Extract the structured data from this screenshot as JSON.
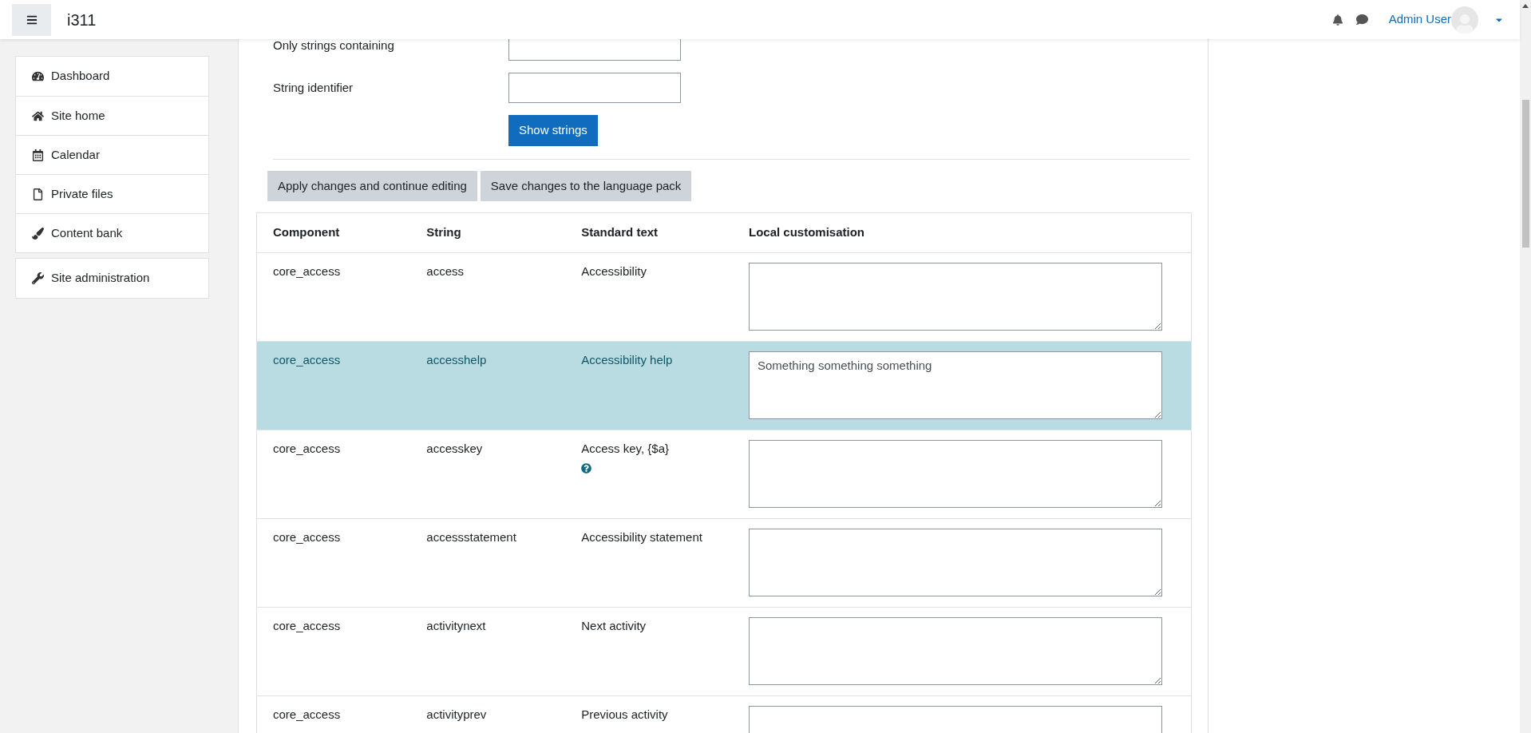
{
  "topbar": {
    "site_name": "i311",
    "user_name": "Admin User"
  },
  "sidebar": {
    "groups": [
      [
        {
          "label": "Dashboard",
          "kind": "dashboard"
        },
        {
          "label": "Site home",
          "kind": "home"
        },
        {
          "label": "Calendar",
          "kind": "calendar"
        },
        {
          "label": "Private files",
          "kind": "file"
        },
        {
          "label": "Content bank",
          "kind": "brush"
        }
      ],
      [
        {
          "label": "Site administration",
          "kind": "wrench"
        }
      ]
    ]
  },
  "filter_form": {
    "fields": [
      {
        "label": "Only strings containing"
      },
      {
        "label": "String identifier"
      }
    ],
    "submit": "Show strings"
  },
  "actions": [
    "Apply changes and continue editing",
    "Save changes to the language pack"
  ],
  "table": {
    "columns": [
      "Component",
      "String",
      "Standard text",
      "Local customisation"
    ],
    "rows": [
      {
        "component": "core_access",
        "string": "access",
        "standard_text": "Accessibility",
        "help": false,
        "customisation": "",
        "selected": false
      },
      {
        "component": "core_access",
        "string": "accesshelp",
        "standard_text": "Accessibility help",
        "help": false,
        "customisation": "Something something something",
        "selected": true
      },
      {
        "component": "core_access",
        "string": "accesskey",
        "standard_text": "Access key, {$a}",
        "help": true,
        "customisation": "",
        "selected": false
      },
      {
        "component": "core_access",
        "string": "accessstatement",
        "standard_text": "Accessibility statement",
        "help": false,
        "customisation": "",
        "selected": false
      },
      {
        "component": "core_access",
        "string": "activitynext",
        "standard_text": "Next activity",
        "help": false,
        "customisation": "",
        "selected": false
      },
      {
        "component": "core_access",
        "string": "activityprev",
        "standard_text": "Previous activity",
        "help": false,
        "customisation": "",
        "selected": false
      }
    ]
  }
}
